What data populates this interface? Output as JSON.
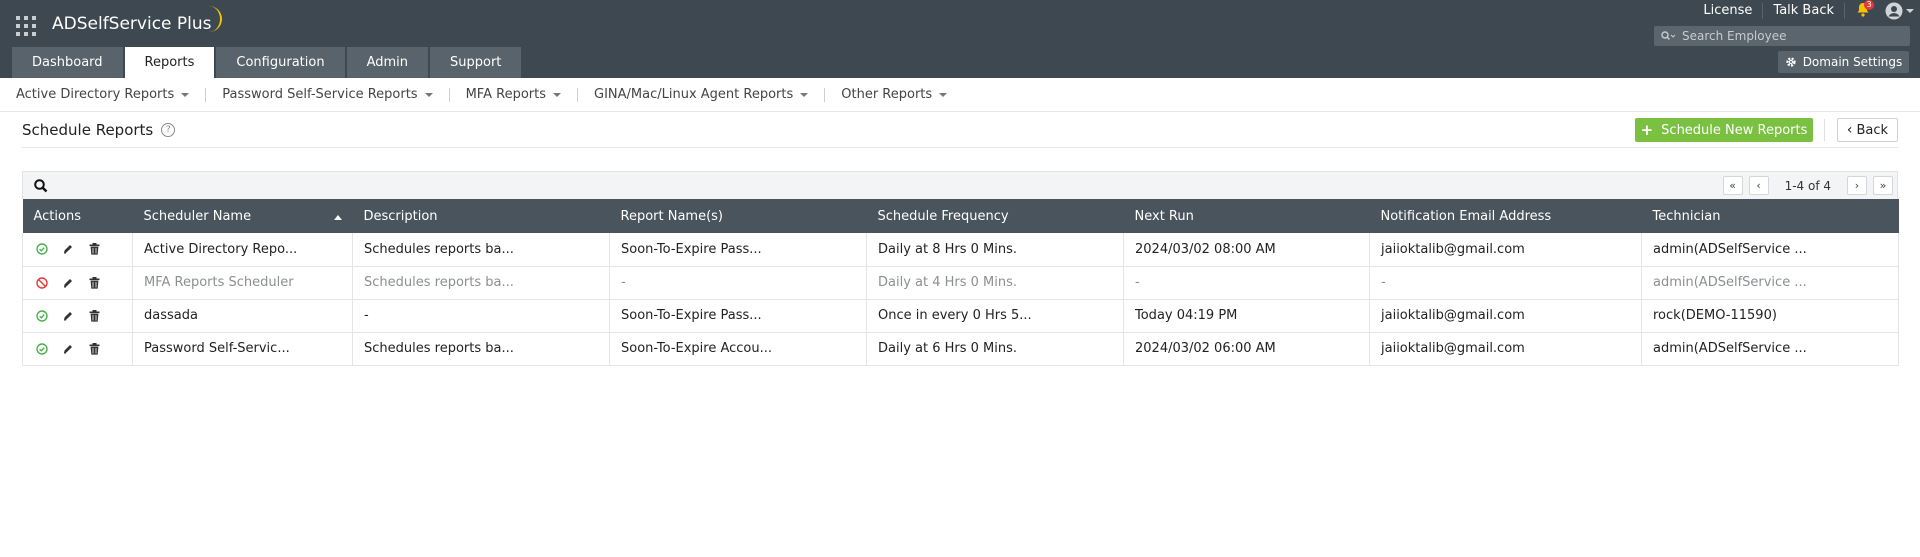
{
  "header": {
    "app_name": "ADSelfService",
    "app_name_suffix": "Plus",
    "top_links": [
      "License",
      "Talk Back"
    ],
    "notification_count": "3",
    "search_placeholder": "Search Employee",
    "domain_settings_label": "Domain Settings",
    "accent_color": "#f4c400"
  },
  "tabs": [
    {
      "label": "Dashboard",
      "active": false
    },
    {
      "label": "Reports",
      "active": true
    },
    {
      "label": "Configuration",
      "active": false
    },
    {
      "label": "Admin",
      "active": false
    },
    {
      "label": "Support",
      "active": false
    }
  ],
  "subnav": [
    "Active Directory Reports",
    "Password Self-Service Reports",
    "MFA Reports",
    "GINA/Mac/Linux Agent Reports",
    "Other Reports"
  ],
  "page": {
    "title": "Schedule Reports",
    "help_icon": "?",
    "schedule_button_label": "Schedule New Reports",
    "back_button_label": "Back",
    "primary_color": "#7ac142"
  },
  "pager": {
    "info": "1-4 of 4",
    "first": "«",
    "prev": "‹",
    "next": "›",
    "last": "»"
  },
  "table": {
    "columns": [
      "Actions",
      "Scheduler Name",
      "Description",
      "Report Name(s)",
      "Schedule Frequency",
      "Next Run",
      "Notification Email Address",
      "Technician"
    ],
    "sorted_column": "Scheduler Name",
    "rows": [
      {
        "status": "enabled",
        "scheduler_name": "Active Directory Repo...",
        "description": "Schedules reports ba...",
        "report_names": "Soon-To-Expire Pass...",
        "frequency": "Daily at 8 Hrs 0 Mins.",
        "next_run": "2024/03/02 08:00 AM",
        "email": "jaiioktalib@gmail.com",
        "technician": "admin(ADSelfService ..."
      },
      {
        "status": "disabled",
        "scheduler_name": "MFA Reports Scheduler",
        "description": "Schedules reports ba...",
        "report_names": "-",
        "frequency": "Daily at 4 Hrs 0 Mins.",
        "next_run": "-",
        "email": "-",
        "technician": "admin(ADSelfService ..."
      },
      {
        "status": "enabled",
        "scheduler_name": "dassada",
        "description": "-",
        "report_names": "Soon-To-Expire Pass...",
        "frequency": "Once in every 0 Hrs 5...",
        "next_run": "Today 04:19 PM",
        "email": "jaiioktalib@gmail.com",
        "technician": "rock(DEMO-11590)"
      },
      {
        "status": "enabled",
        "scheduler_name": "Password Self-Servic...",
        "description": "Schedules reports ba...",
        "report_names": "Soon-To-Expire Accou...",
        "frequency": "Daily at 6 Hrs 0 Mins.",
        "next_run": "2024/03/02 06:00 AM",
        "email": "jaiioktalib@gmail.com",
        "technician": "admin(ADSelfService ..."
      }
    ]
  },
  "icons": {
    "enabled": "check-circle-icon",
    "disabled": "disabled-circle-icon",
    "edit": "pencil-icon",
    "delete": "trash-icon"
  }
}
